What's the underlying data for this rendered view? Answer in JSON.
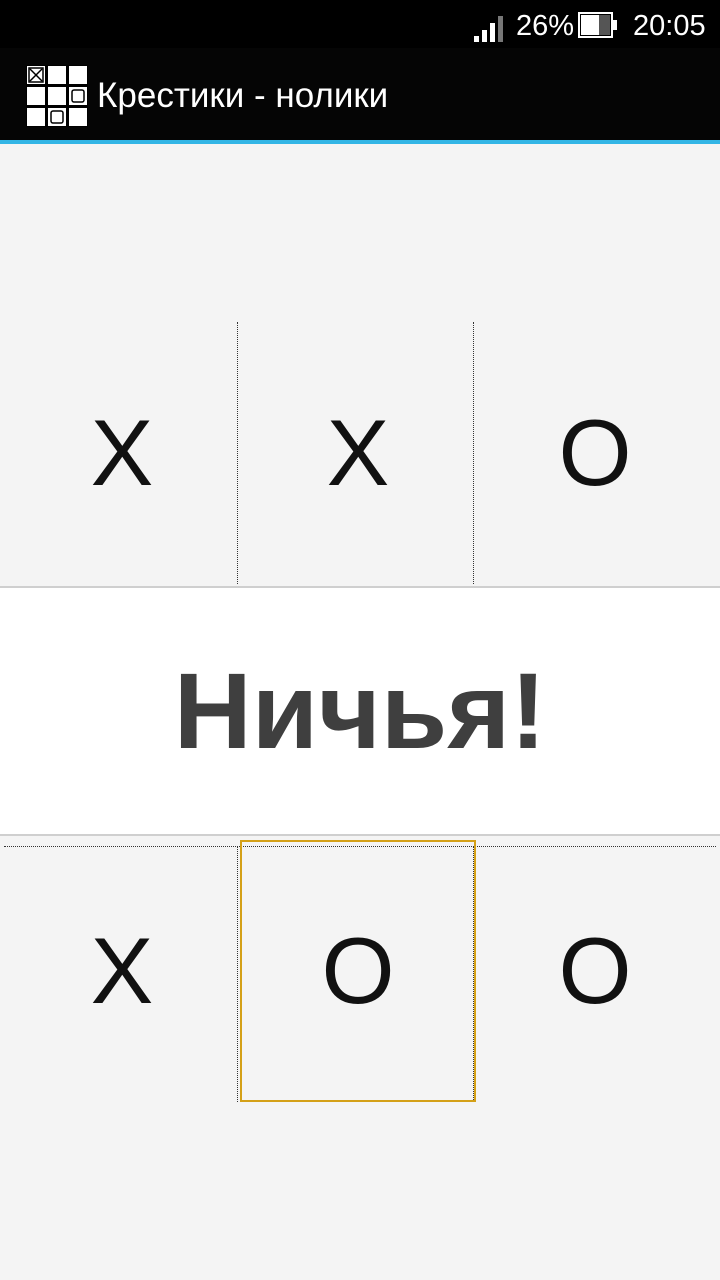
{
  "status_bar": {
    "battery_percent": "26%",
    "time": "20:05",
    "battery_level": 0.26,
    "icons": [
      "signal-icon",
      "battery-icon"
    ]
  },
  "app": {
    "title": "Крестики - нолики",
    "icon": "tic-tac-toe-grid-icon"
  },
  "board": {
    "rows": [
      [
        "X",
        "X",
        "O"
      ],
      [
        "",
        "",
        ""
      ],
      [
        "X",
        "O",
        "O"
      ]
    ],
    "selected_cell": "2,1"
  },
  "result": {
    "text": "Ничья!"
  },
  "colors": {
    "accent": "#33b5e5",
    "selection": "#d4a017",
    "background": "#f4f4f4",
    "result_text": "#3f3f3f"
  }
}
